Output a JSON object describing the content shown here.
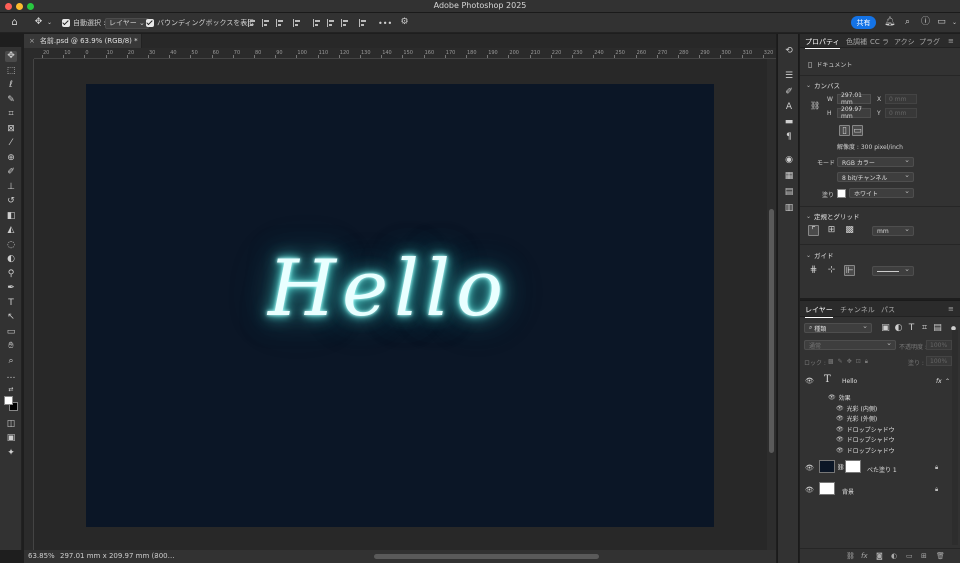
{
  "window": {
    "title": "Adobe Photoshop 2025"
  },
  "options_bar": {
    "auto_select_label": "自動選択 :",
    "auto_select_target": "レイヤー",
    "bounding_box_label": "バウンディングボックスを表示",
    "more": "•••",
    "share_label": "共有"
  },
  "document_tab": {
    "title": "名前.psd @ 63.9% (RGB/8) *",
    "close": "×"
  },
  "rulers": {
    "top_ticks": [
      "20",
      "10",
      "0",
      "10",
      "20",
      "30",
      "40",
      "50",
      "60",
      "70",
      "80",
      "90",
      "100",
      "110",
      "120",
      "130",
      "140",
      "150",
      "160",
      "170",
      "180",
      "190",
      "200",
      "210",
      "220",
      "230",
      "240",
      "250",
      "260",
      "270",
      "280",
      "290",
      "300",
      "310",
      "320"
    ]
  },
  "canvas": {
    "text": "Hello",
    "background": "#0b1626",
    "glow_color": "#6ff2ea"
  },
  "status_bar": {
    "zoom": "63.85%",
    "doc_info": "297.01 mm x 209.97 mm (300…",
    "arrow": "›"
  },
  "properties_panel": {
    "tabs": [
      "プロパティ",
      "色調補",
      "CC ラ",
      "アクシ",
      "プラグ"
    ],
    "doc_label": "ドキュメント",
    "canvas_section": "カンバス",
    "width_label": "W",
    "width_value": "297.01 mm",
    "x_label": "X",
    "x_placeholder": "0 mm",
    "height_label": "H",
    "height_value": "209.97 mm",
    "y_label": "Y",
    "y_placeholder": "0 mm",
    "resolution": "解像度 : 300 pixel/inch",
    "mode_label": "モード",
    "mode_value": "RGB カラー",
    "bit_value": "8 bit/チャンネル",
    "fill_label": "塗り",
    "fill_value": "ホワイト",
    "rulers_grid_section": "定規とグリッド",
    "unit_value": "mm",
    "guides_section": "ガイド"
  },
  "layers_panel": {
    "tabs": [
      "レイヤー",
      "チャンネル",
      "パス"
    ],
    "filter_value": "種類",
    "blend_mode": "通常",
    "opacity_label": "不透明度 :",
    "opacity_value": "100%",
    "lock_label": "ロック :",
    "fill_label": "塗り :",
    "fill_value": "100%",
    "layers": [
      {
        "name": "Hello",
        "fx": "fx"
      },
      {
        "name": "べた塗り 1"
      },
      {
        "name": "背景"
      }
    ],
    "effects_label": "効果",
    "effects": [
      "光彩 (内側)",
      "光彩 (外側)",
      "ドロップシャドウ",
      "ドロップシャドウ",
      "ドロップシャドウ"
    ]
  }
}
